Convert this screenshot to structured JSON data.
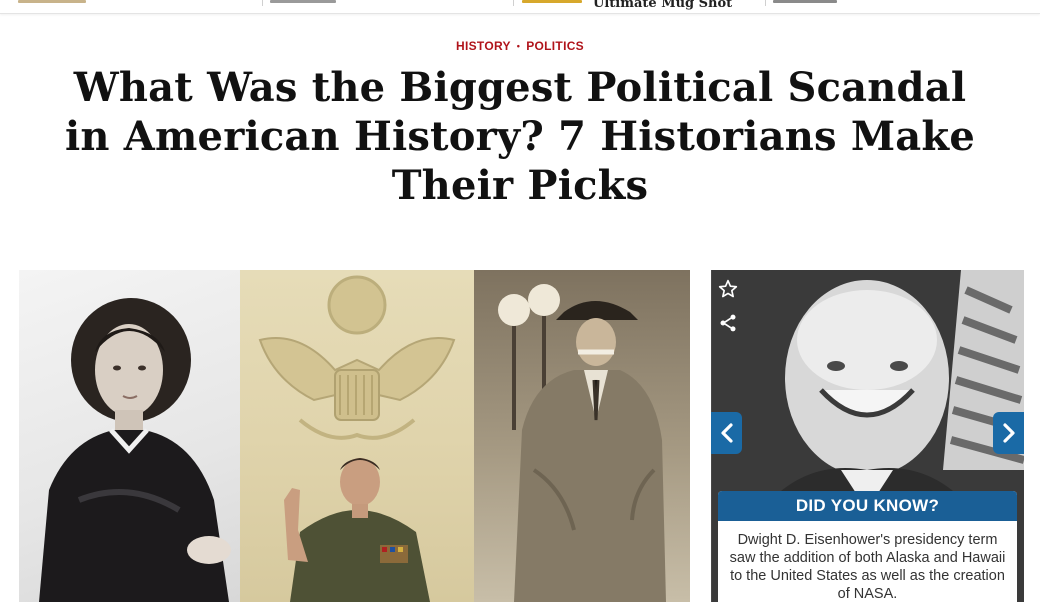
{
  "top_strip": {
    "caption": "Ultimate Mug Shot"
  },
  "article": {
    "categories": [
      "HISTORY",
      "POLITICS"
    ],
    "separator": "•",
    "title": "What Was the Biggest Political Scandal in American History? 7 Historians Make Their Picks"
  },
  "hero": {
    "panels": [
      "portrait-woman",
      "great-seal-testimony",
      "man-in-suit"
    ]
  },
  "sidebar_card": {
    "icons": [
      "star-icon",
      "share-icon",
      "chevron-left-icon",
      "chevron-right-icon"
    ],
    "heading": "DID YOU KNOW?",
    "fact": "Dwight D. Eisenhower's presidency term saw the addition of both Alaska and Hawaii to the United States as well as the creation of NASA."
  },
  "colors": {
    "category": "#b0141b",
    "card_header": "#1a5f96",
    "nav_button": "#1a6aa6"
  }
}
